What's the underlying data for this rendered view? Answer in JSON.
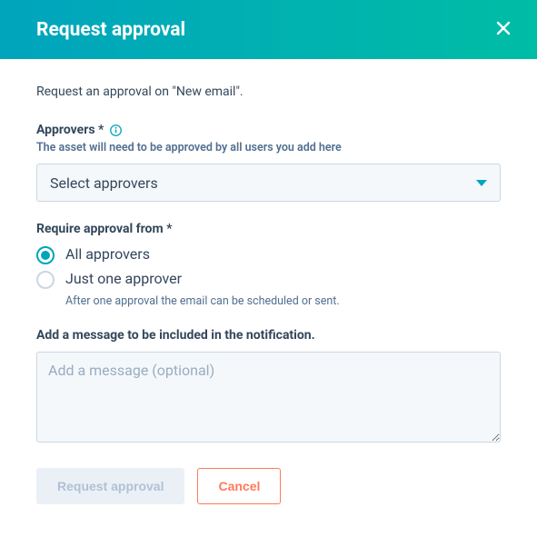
{
  "header": {
    "title": "Request approval"
  },
  "intro": "Request an approval on \"New email\".",
  "approvers": {
    "label": "Approvers *",
    "helper": "The asset will need to be approved by all users you add here",
    "placeholder": "Select approvers"
  },
  "requireFrom": {
    "label": "Require approval from *",
    "options": {
      "all": {
        "label": "All approvers"
      },
      "one": {
        "label": "Just one approver",
        "sub": "After one approval the email can be scheduled or sent."
      }
    },
    "selected": "all"
  },
  "message": {
    "label": "Add a message to be included in the notification.",
    "placeholder": "Add a message (optional)"
  },
  "actions": {
    "primary": "Request approval",
    "secondary": "Cancel"
  }
}
